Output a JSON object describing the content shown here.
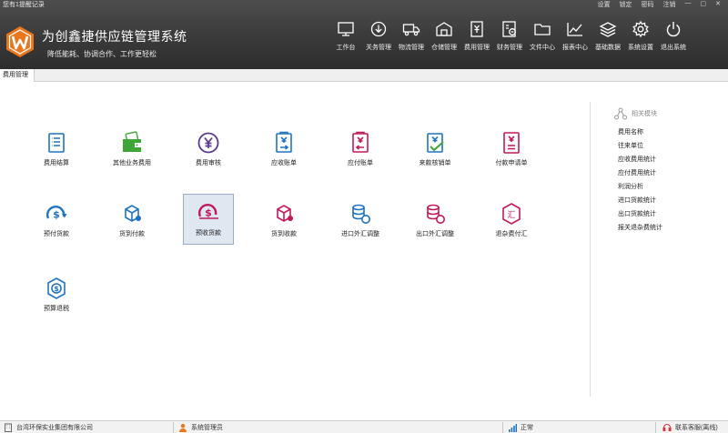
{
  "header": {
    "notice": "您有1提醒记录",
    "window_buttons": [
      "设置",
      "锁定",
      "密码",
      "注销",
      "—",
      "▢",
      "✕"
    ],
    "title": "为创鑫捷供应链管理系统",
    "subtitle": "降低能耗、协调合作、工作更轻松",
    "nav": [
      {
        "label": "工作台",
        "icon": "monitor-icon"
      },
      {
        "label": "关务管理",
        "icon": "download-circle-icon"
      },
      {
        "label": "物流管理",
        "icon": "truck-icon"
      },
      {
        "label": "仓储管理",
        "icon": "warehouse-icon"
      },
      {
        "label": "费用管理",
        "icon": "yen-document-icon"
      },
      {
        "label": "财务管理",
        "icon": "finance-icon"
      },
      {
        "label": "文件中心",
        "icon": "folder-icon"
      },
      {
        "label": "报表中心",
        "icon": "line-chart-icon"
      },
      {
        "label": "基础数据",
        "icon": "layers-icon"
      },
      {
        "label": "系统设置",
        "icon": "gear-icon"
      },
      {
        "label": "退出系统",
        "icon": "power-icon"
      }
    ]
  },
  "tabs": {
    "active": "费用管理"
  },
  "functions": [
    {
      "label": "费用结算",
      "icon": "settlement-icon"
    },
    {
      "label": "其他业务费用",
      "icon": "wallet-icon"
    },
    {
      "label": "费用审核",
      "icon": "yen-circle-icon"
    },
    {
      "label": "应收账单",
      "icon": "receivable-bill-icon"
    },
    {
      "label": "应付账单",
      "icon": "payable-bill-icon"
    },
    {
      "label": "来款核销单",
      "icon": "check-bill-icon"
    },
    {
      "label": "付款申请单",
      "icon": "payment-request-icon"
    },
    {
      "label": "预付货款",
      "icon": "prepaid-icon"
    },
    {
      "label": "货到付款",
      "icon": "cod-box-icon"
    },
    {
      "label": "预收货款",
      "icon": "advance-receipt-icon",
      "selected": true
    },
    {
      "label": "货到收款",
      "icon": "collect-box-icon"
    },
    {
      "label": "进口外汇调整",
      "icon": "import-fx-icon"
    },
    {
      "label": "出口外汇调整",
      "icon": "export-fx-icon"
    },
    {
      "label": "退杂费付汇",
      "icon": "refund-fee-icon"
    },
    {
      "label": "预算退税",
      "icon": "tax-refund-icon"
    }
  ],
  "side": {
    "header": "相关模块",
    "items": [
      "费用名称",
      "往来单位",
      "应收费用统计",
      "应付费用统计",
      "利润分析",
      "进口货款统计",
      "出口货款统计",
      "报关退杂费统计"
    ]
  },
  "status": {
    "company": "台湾环保实业集团有限公司",
    "user": "系统管理员",
    "state": "正常",
    "service": "联系客服(离线)"
  },
  "colors": {
    "header_bg": "#3a3a3a",
    "logo_orange": "#e8771e",
    "blue": "#1e73be",
    "green": "#3da637",
    "purple": "#5b3a8c",
    "magenta": "#c2185b",
    "selected_bg": "#dfe7f1"
  }
}
